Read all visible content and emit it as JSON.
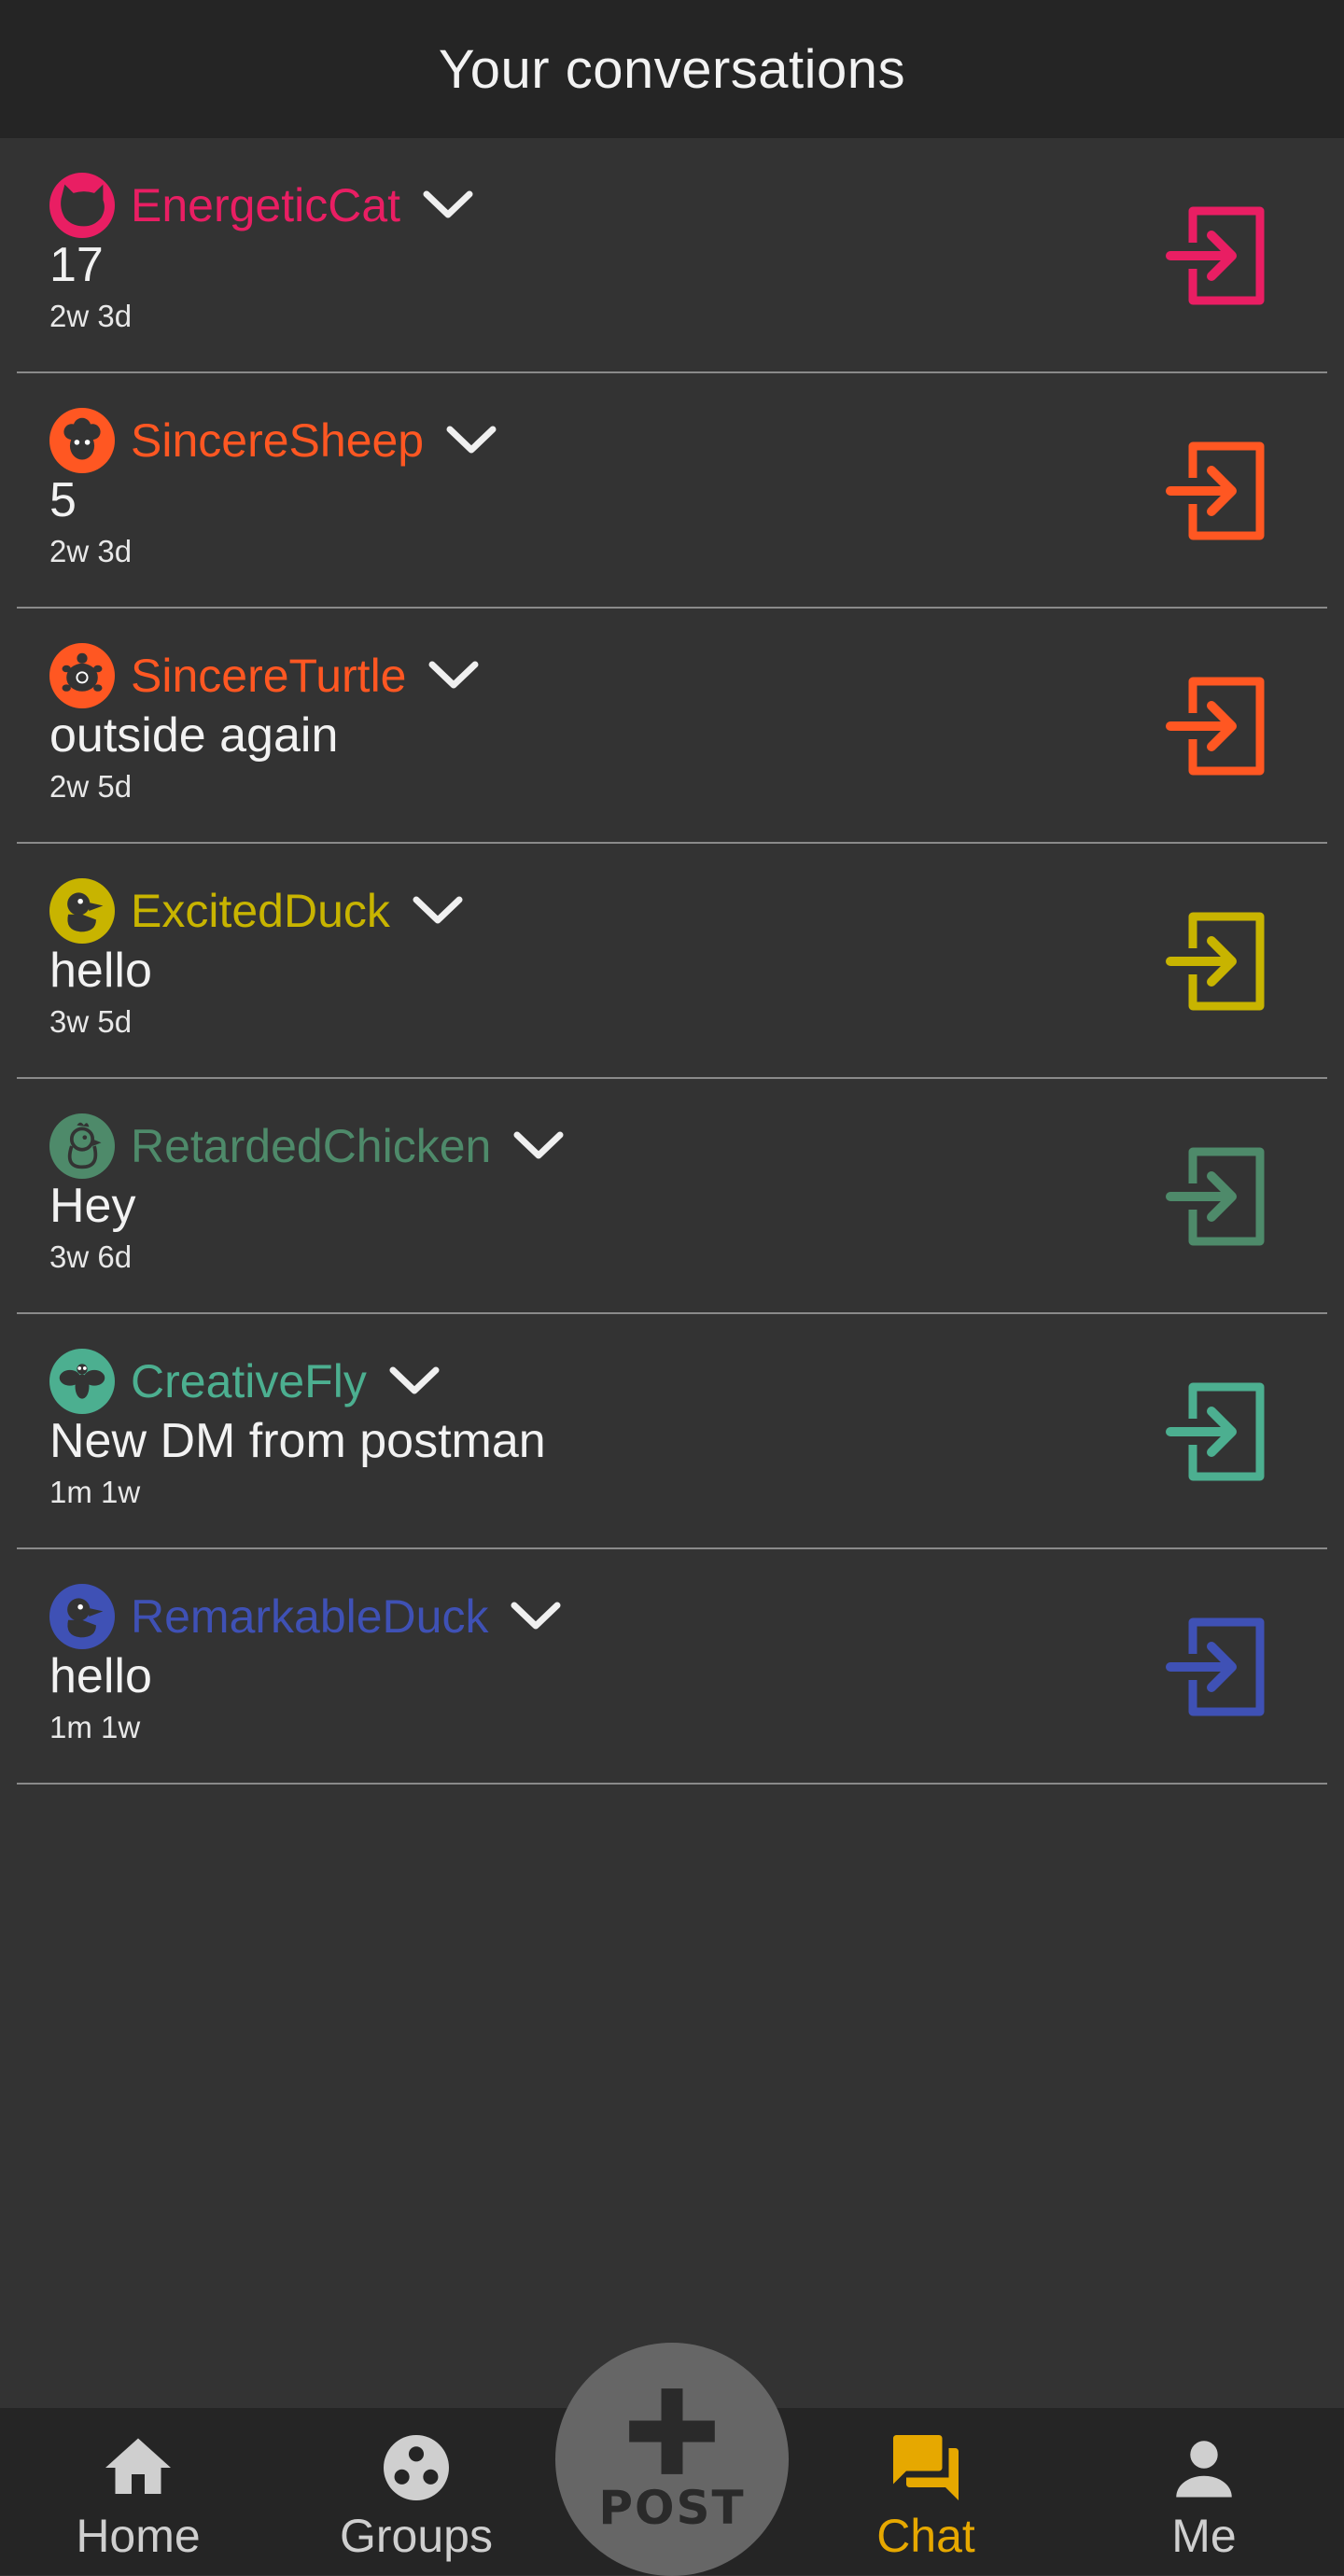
{
  "header": {
    "title": "Your conversations"
  },
  "conversations": [
    {
      "name": "EnergeticCat",
      "message": "17",
      "time": "2w 3d",
      "color": "#e91e63",
      "avatar_icon": "cat-icon"
    },
    {
      "name": "SincereSheep",
      "message": "5",
      "time": "2w 3d",
      "color": "#ff5722",
      "avatar_icon": "sheep-icon"
    },
    {
      "name": "SincereTurtle",
      "message": "outside again",
      "time": "2w 5d",
      "color": "#ff5722",
      "avatar_icon": "turtle-icon"
    },
    {
      "name": "ExcitedDuck",
      "message": "hello",
      "time": "3w 5d",
      "color": "#c8b400",
      "avatar_icon": "duck-icon"
    },
    {
      "name": "RetardedChicken",
      "message": "Hey",
      "time": "3w 6d",
      "color": "#4e8a6a",
      "avatar_icon": "chicken-icon"
    },
    {
      "name": "CreativeFly",
      "message": "New DM from postman",
      "time": "1m 1w",
      "color": "#4caf90",
      "avatar_icon": "fly-icon"
    },
    {
      "name": "RemarkableDuck",
      "message": "hello",
      "time": "1m 1w",
      "color": "#3f51b5",
      "avatar_icon": "duck-icon"
    }
  ],
  "nav": {
    "home": "Home",
    "groups": "Groups",
    "post": "POST",
    "chat": "Chat",
    "me": "Me",
    "active_color": "#e6a800",
    "inactive_color": "#cfcfcf"
  }
}
